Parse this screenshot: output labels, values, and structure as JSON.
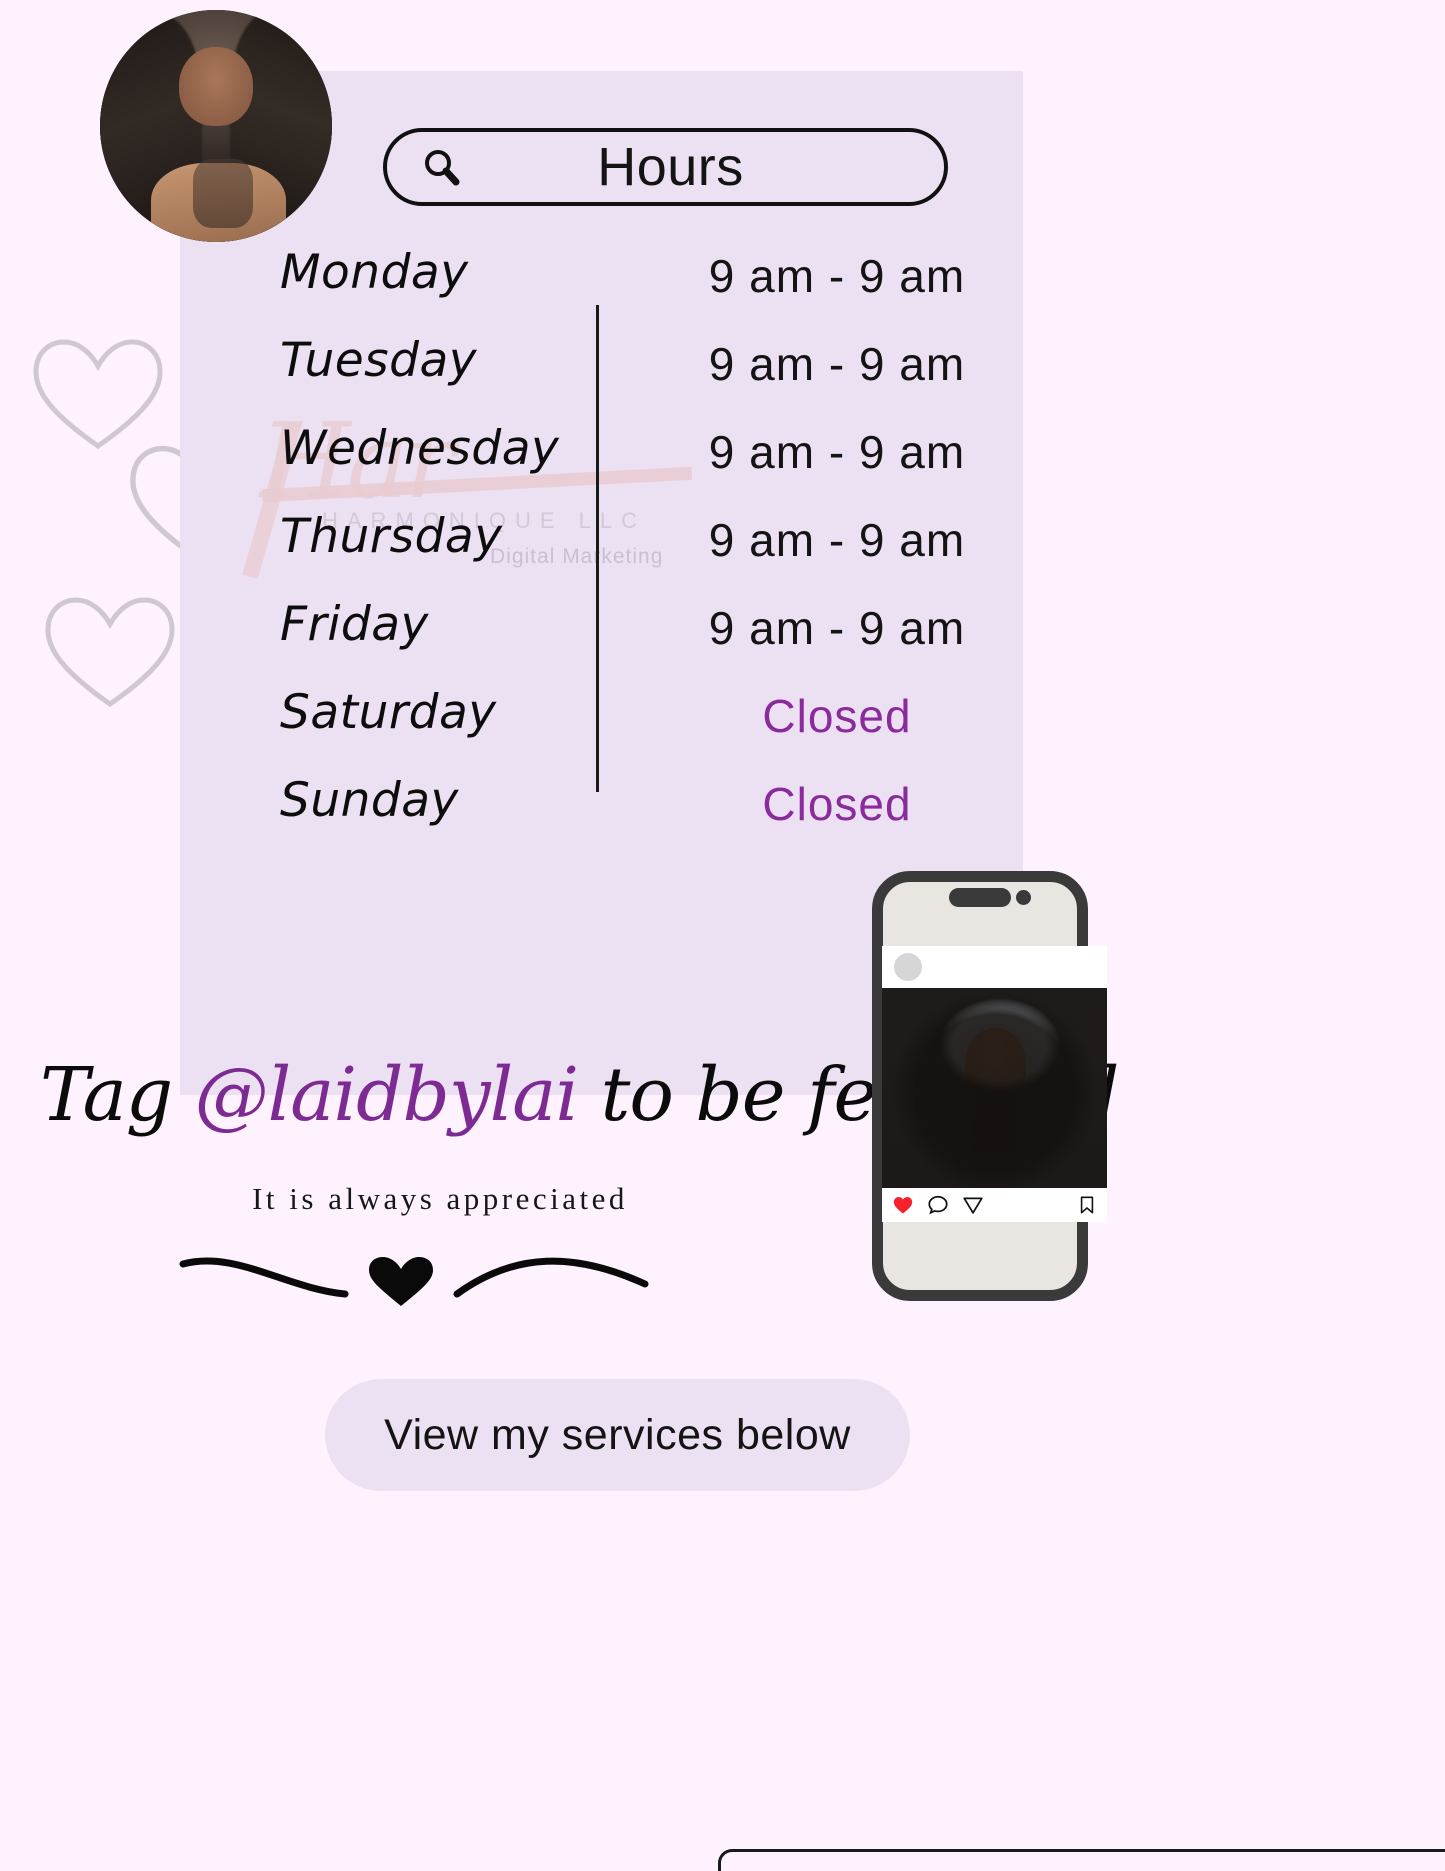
{
  "page": {
    "background_color": "#fdf2fd",
    "card_color": "#ece1f2",
    "accent_purple": "#8a2a9c"
  },
  "header": {
    "search_icon": "search-icon",
    "title": "Hours"
  },
  "avatar": {
    "alt": "profile-photo-curly-hair-model"
  },
  "watermark": {
    "script": "Har",
    "brand": "HARMONIQUE LLC",
    "tagline": "Digital Marketing"
  },
  "hours": {
    "rows": [
      {
        "day": "Monday",
        "time": "9 am - 9 am",
        "closed": false
      },
      {
        "day": "Tuesday",
        "time": "9 am - 9 am",
        "closed": false
      },
      {
        "day": "Wednesday",
        "time": "9 am - 9 am",
        "closed": false
      },
      {
        "day": "Thursday",
        "time": "9 am - 9 am",
        "closed": false
      },
      {
        "day": "Friday",
        "time": "9 am - 9 am",
        "closed": false
      },
      {
        "day": "Saturday",
        "time": "Closed",
        "closed": true
      },
      {
        "day": "Sunday",
        "time": "Closed",
        "closed": true
      }
    ]
  },
  "tag": {
    "prefix": "Tag ",
    "handle": "@laidbylai",
    "suffix": " to be featured",
    "subtitle": "It is always appreciated"
  },
  "phone": {
    "post_actions": {
      "like_icon": "heart-icon",
      "like_color": "#f5222d",
      "comment_icon": "comment-icon",
      "share_icon": "paper-plane-icon",
      "save_icon": "bookmark-icon"
    },
    "post_image_alt": "curly-hair-closeup-photo"
  },
  "services": {
    "label": "View my services below"
  },
  "decor": {
    "hearts": [
      "heart-outline-1",
      "heart-outline-2",
      "heart-outline-3"
    ],
    "flourish": "heart-flourish-divider"
  }
}
